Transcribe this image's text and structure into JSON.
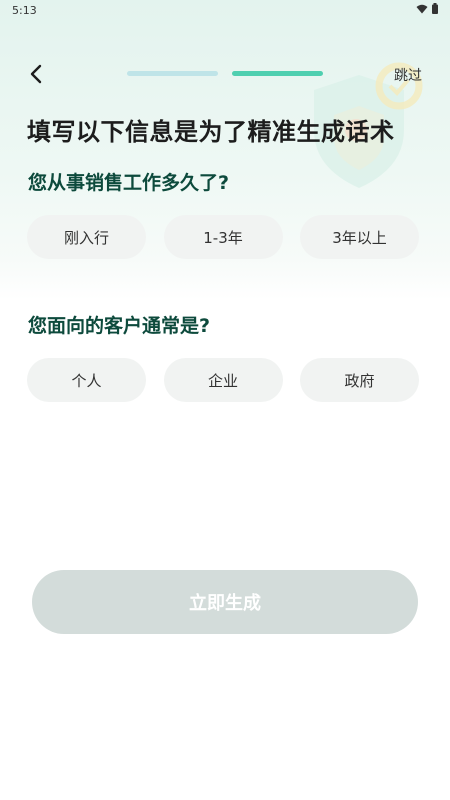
{
  "status_bar": {
    "time": "5:13",
    "wifi_icon": "wifi-icon",
    "battery_icon": "battery-icon"
  },
  "header": {
    "back_icon": "chevron-left-icon",
    "skip_label": "跳过",
    "progress": {
      "total_steps": 2,
      "current_step": 2
    }
  },
  "headline": "填写以下信息是为了精准生成话术",
  "questions": [
    {
      "title": "您从事销售工作多久了?",
      "options": [
        "刚入行",
        "1-3年",
        "3年以上"
      ]
    },
    {
      "title": "您面向的客户通常是?",
      "options": [
        "个人",
        "企业",
        "政府"
      ]
    }
  ],
  "submit_label": "立即生成",
  "colors": {
    "accent": "#4fcfb0",
    "progress_inactive": "#bfe4e8",
    "question_text": "#0d4a3c",
    "option_bg": "#f1f3f2",
    "button_disabled": "#d3dcda"
  }
}
